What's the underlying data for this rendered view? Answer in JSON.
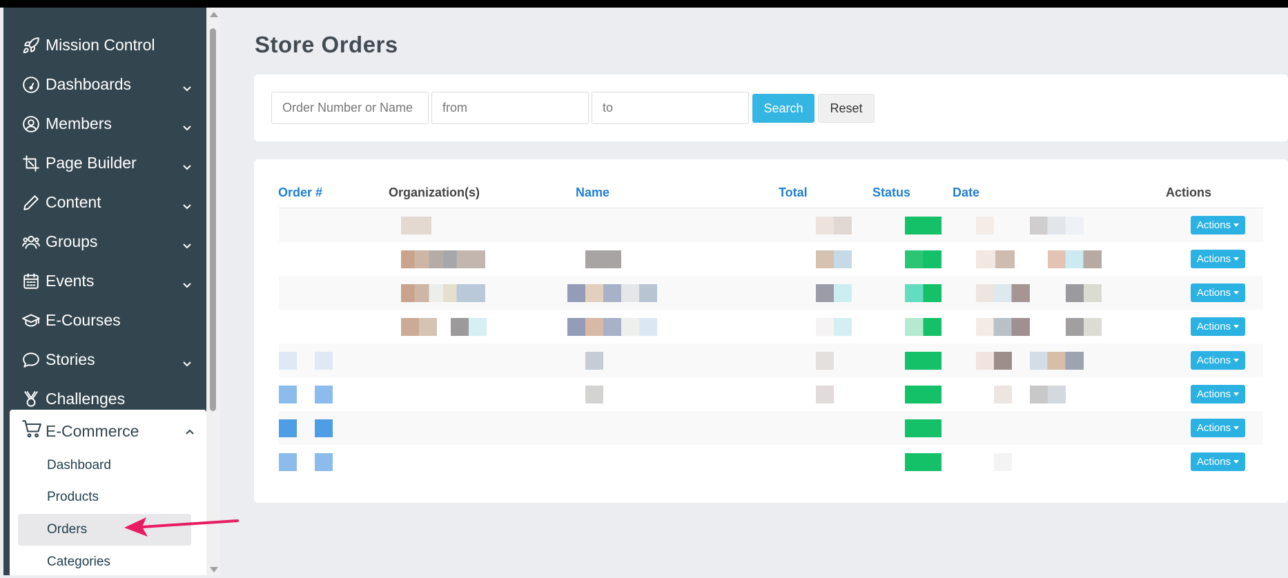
{
  "sidebar": {
    "items": [
      {
        "label": "Mission Control",
        "icon": "rocket-icon",
        "has_chevron": false
      },
      {
        "label": "Dashboards",
        "icon": "gauge-icon",
        "has_chevron": true
      },
      {
        "label": "Members",
        "icon": "user-circle-icon",
        "has_chevron": true
      },
      {
        "label": "Page Builder",
        "icon": "crop-icon",
        "has_chevron": true
      },
      {
        "label": "Content",
        "icon": "pencil-icon",
        "has_chevron": true
      },
      {
        "label": "Groups",
        "icon": "users-icon",
        "has_chevron": true
      },
      {
        "label": "Events",
        "icon": "calendar-icon",
        "has_chevron": true
      },
      {
        "label": "E-Courses",
        "icon": "graduation-cap-icon",
        "has_chevron": false
      },
      {
        "label": "Stories",
        "icon": "speech-bubble-icon",
        "has_chevron": true
      },
      {
        "label": "Challenges",
        "icon": "medal-icon",
        "has_chevron": false
      }
    ],
    "ecommerce": {
      "label": "E-Commerce",
      "icon": "cart-icon",
      "expanded": true,
      "sub_items": [
        {
          "label": "Dashboard",
          "active": false
        },
        {
          "label": "Products",
          "active": false
        },
        {
          "label": "Orders",
          "active": true
        },
        {
          "label": "Categories",
          "active": false
        }
      ]
    }
  },
  "main": {
    "title": "Store Orders",
    "search": {
      "order_placeholder": "Order Number or Name",
      "from_placeholder": "from",
      "to_placeholder": "to",
      "search_label": "Search",
      "reset_label": "Reset"
    },
    "table": {
      "columns": [
        "Order #",
        "Organization(s)",
        "Name",
        "Total",
        "Status",
        "Date",
        "Actions"
      ],
      "action_label": "Actions",
      "row_count": 8
    }
  },
  "colors": {
    "sidebar_bg": "#33454f",
    "accent_blue": "#35b5e2",
    "link_blue": "#1e7fd6",
    "status_green": "#14c168",
    "annotation_arrow": "#e81c62"
  }
}
